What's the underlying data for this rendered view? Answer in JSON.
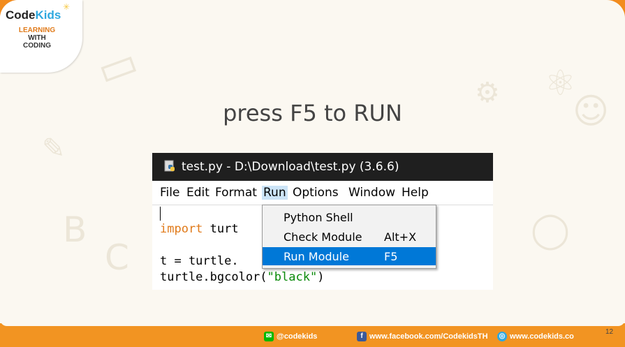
{
  "logo": {
    "brand_code": "Code",
    "brand_kids": "Kids",
    "line1": "LEARNING",
    "line2": "WITH",
    "line3": "CODING"
  },
  "slide": {
    "title": "press F5 to RUN",
    "page_number": "12"
  },
  "window": {
    "title": "test.py - D:\\Download\\test.py (3.6.6)",
    "menu": [
      "File",
      "Edit",
      "Format",
      "Run",
      "Options",
      "Window",
      "Help"
    ],
    "active_menu": "Run"
  },
  "editor": {
    "line1_kw": "import",
    "line1_rest": " turt",
    "line3": "t = turtle.",
    "line4_pre": "turtle.bgcolor(",
    "line4_str": "\"black\"",
    "line4_post": ")"
  },
  "run_menu": {
    "items": [
      {
        "label": "Python Shell",
        "accel": ""
      },
      {
        "label": "Check Module",
        "accel": "Alt+X"
      },
      {
        "label": "Run Module",
        "accel": "F5"
      }
    ],
    "highlight_color": "#0078d7"
  },
  "footer": {
    "line": "@codekids",
    "facebook": "www.facebook.com/CodekidsTH",
    "web": "www.codekids.co"
  },
  "colors": {
    "accent_orange": "#f29422",
    "keyword": "#e07a1a",
    "string": "#0a8a0a"
  }
}
